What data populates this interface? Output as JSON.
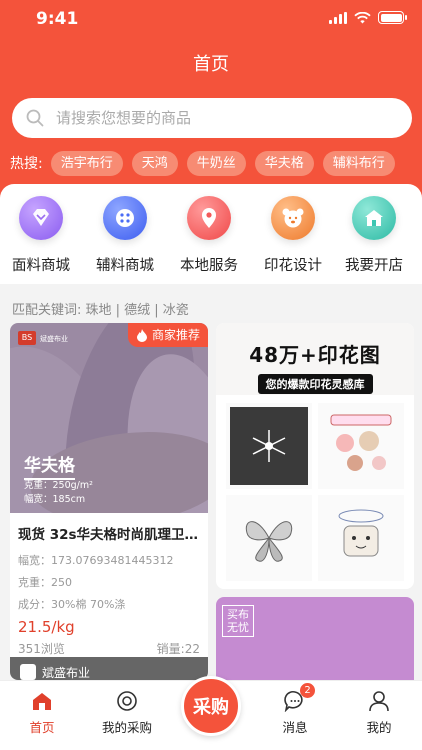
{
  "status_bar": {
    "time": "9:41"
  },
  "header": {
    "title": "首页"
  },
  "search": {
    "placeholder": "请搜索您想要的商品"
  },
  "hot_search": {
    "label": "热搜:",
    "tags": [
      "浩宇布行",
      "天鸿",
      "牛奶丝",
      "华夫格",
      "辅料布行"
    ]
  },
  "categories": [
    {
      "label": "面料商城",
      "icon": "fabric-diamond-icon",
      "color": "#9b6cf0"
    },
    {
      "label": "辅料商城",
      "icon": "button-icon",
      "color": "#4a6cf5"
    },
    {
      "label": "本地服务",
      "icon": "location-pin-icon",
      "color": "#f35a5a"
    },
    {
      "label": "印花设计",
      "icon": "bear-icon",
      "color": "#f08a3c"
    },
    {
      "label": "我要开店",
      "icon": "store-icon",
      "color": "#3cc6b2"
    }
  ],
  "keywords": {
    "text": "匹配关键词: 珠地 | 德绒 | 冰瓷"
  },
  "product": {
    "badge": "商家推荐",
    "image_brand_logo": "BS",
    "image_brand": "斌盛布业",
    "image_name": "华夫格",
    "image_spec_weight": "克重：250g/m²",
    "image_spec_width": "幅宽：185cm",
    "title": "现货 32s华夫格时尚肌理卫衣...",
    "width": "幅宽：173.07693481445312",
    "weight": "克重：250",
    "composition": "成分：30%棉 70%涤",
    "price": "21.5/kg",
    "views": "351浏览",
    "sales": "销量:22",
    "shop_name": "斌盛布业"
  },
  "promo": {
    "headline": "48万+印花图",
    "subline": "您的爆款印花灵感库",
    "tiles": [
      "snowflake-print",
      "strawberry-print",
      "butterfly-print",
      "cat-print"
    ]
  },
  "promo2": {
    "tag": "买布无忧"
  },
  "tabbar": {
    "home": "首页",
    "purchases": "我的采购",
    "center": "采购",
    "messages": "消息",
    "messages_badge": "2",
    "mine": "我的"
  },
  "colors": {
    "brand": "#f4533b",
    "price": "#e0402b"
  }
}
